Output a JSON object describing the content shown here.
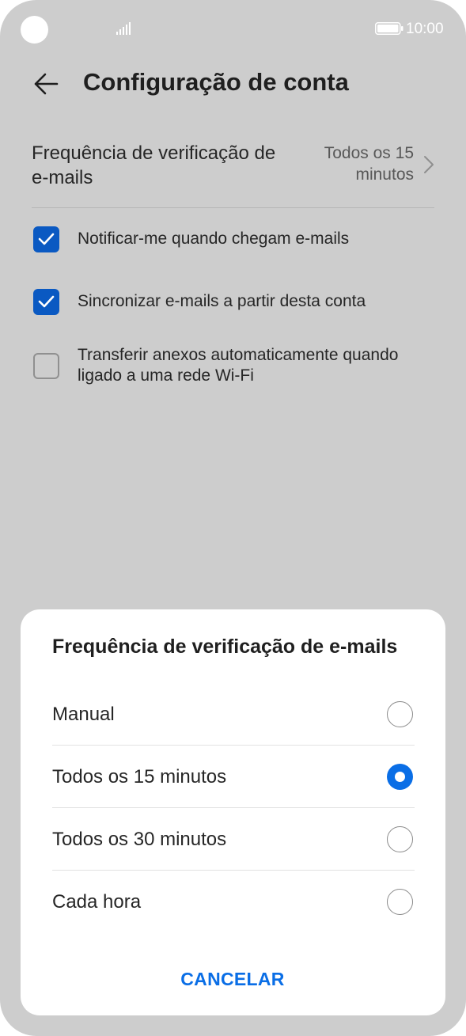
{
  "status_bar": {
    "time": "10:00",
    "icons": [
      "camera-cutout",
      "signal-icon",
      "battery-icon"
    ]
  },
  "header": {
    "back_icon": "back-arrow-icon",
    "title": "Configuração de conta"
  },
  "settings": {
    "frequency": {
      "label": "Frequência de verificação de e-mails",
      "value": "Todos os 15 minutos",
      "chevron_icon": "chevron-right-icon"
    },
    "checkboxes": [
      {
        "label": "Notificar-me quando chegam e-mails",
        "checked": true
      },
      {
        "label": "Sincronizar e-mails a partir desta conta",
        "checked": true
      },
      {
        "label": "Transferir anexos automaticamente quando ligado a uma rede Wi-Fi",
        "checked": false
      }
    ]
  },
  "dialog": {
    "title": "Frequência de verificação de e-mails",
    "options": [
      {
        "label": "Manual",
        "selected": false
      },
      {
        "label": "Todos os 15 minutos",
        "selected": true
      },
      {
        "label": "Todos os 30 minutos",
        "selected": false
      },
      {
        "label": "Cada hora",
        "selected": false
      }
    ],
    "cancel_label": "CANCELAR"
  },
  "colors": {
    "accent": "#0a6ee6",
    "checkbox": "#0a59c2",
    "overlay_background": "#cdcdcd"
  }
}
